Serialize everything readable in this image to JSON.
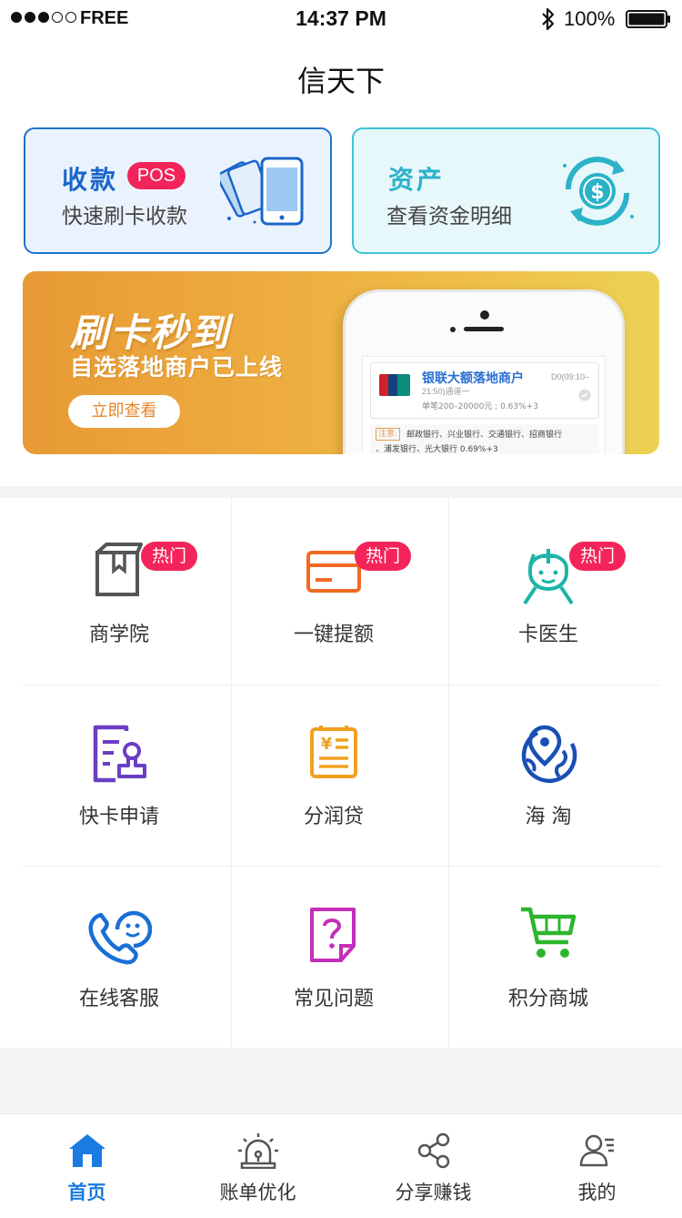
{
  "status_bar": {
    "signal_filled": 3,
    "signal_total": 5,
    "carrier": "FREE",
    "time": "14:37 PM",
    "battery_percent": "100%",
    "battery_level": 1.0
  },
  "header": {
    "title": "信天下"
  },
  "cards": {
    "pos": {
      "title": "收款",
      "badge": "POS",
      "subtitle": "快速刷卡收款",
      "icon": "card-swipe-phone-icon"
    },
    "asset": {
      "title": "资产",
      "subtitle": "查看资金明细",
      "icon": "dollar-cycle-icon"
    }
  },
  "banner": {
    "title": "刷卡秒到",
    "subtitle": "自选落地商户已上线",
    "button_label": "立即查看",
    "phone_screen": {
      "merchant_name": "银联大额落地商户",
      "merchant_time_a": "D0(09:10–",
      "merchant_time_b": "21:50)通道一",
      "merchant_limit": "单笔200–20000元 ; 0.63%+3",
      "note_tag": "注意:",
      "note_line1": "邮政银行、兴业银行、交通银行、招商银行",
      "note_line2": "、浦发银行、光大银行 0.69%+3"
    }
  },
  "grid": {
    "hot_label": "热门",
    "items": [
      {
        "label": "商学院",
        "icon": "book-icon",
        "hot": true,
        "color": "#555555"
      },
      {
        "label": "一键提额",
        "icon": "credit-card-icon",
        "hot": true,
        "color": "#f26a22"
      },
      {
        "label": "卡医生",
        "icon": "doctor-icon",
        "hot": true,
        "color": "#1bb5a6"
      },
      {
        "label": "快卡申请",
        "icon": "application-form-icon",
        "hot": false,
        "color": "#6a3fc4"
      },
      {
        "label": "分润贷",
        "icon": "yen-receipt-icon",
        "hot": false,
        "color": "#f0a020"
      },
      {
        "label": "海 淘",
        "icon": "globe-pin-icon",
        "hot": false,
        "color": "#1a4fb5"
      },
      {
        "label": "在线客服",
        "icon": "customer-service-icon",
        "hot": false,
        "color": "#1a6fd6"
      },
      {
        "label": "常见问题",
        "icon": "question-doc-icon",
        "hot": false,
        "color": "#c22fb8"
      },
      {
        "label": "积分商城",
        "icon": "shopping-cart-icon",
        "hot": false,
        "color": "#2cb52c"
      }
    ]
  },
  "tab_bar": {
    "items": [
      {
        "label": "首页",
        "icon": "home-icon",
        "active": true
      },
      {
        "label": "账单优化",
        "icon": "alarm-light-icon",
        "active": false
      },
      {
        "label": "分享赚钱",
        "icon": "share-icon",
        "active": false
      },
      {
        "label": "我的",
        "icon": "profile-icon",
        "active": false
      }
    ]
  },
  "colors": {
    "accent_blue": "#1a7be0",
    "hot_red": "#f2245a",
    "banner_orange": "#e79a35"
  }
}
